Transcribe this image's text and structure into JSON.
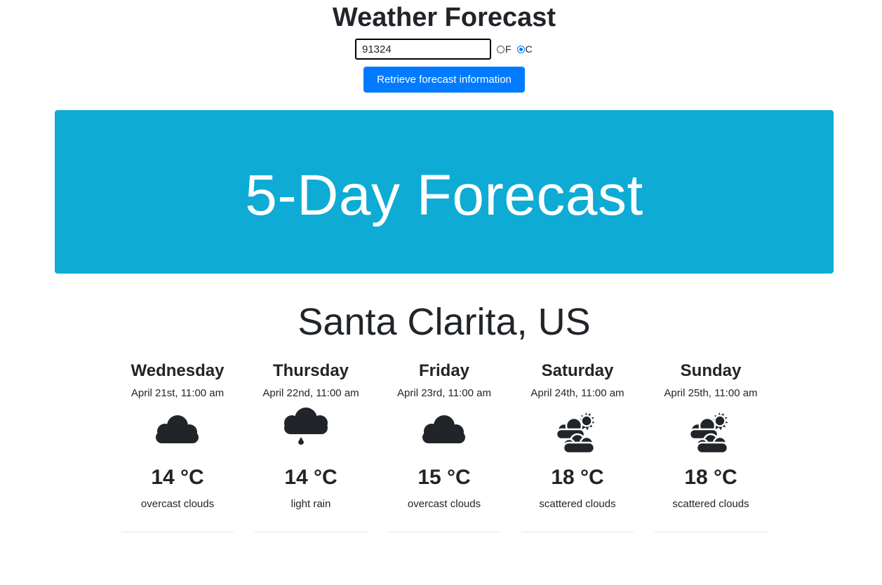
{
  "header": {
    "title": "Weather Forecast"
  },
  "form": {
    "zip_value": "91324",
    "unit_f_label": "F",
    "unit_c_label": "C",
    "selected_unit": "C",
    "submit_label": "Retrieve forecast information"
  },
  "jumbotron": {
    "title": "5-Day Forecast",
    "background_color": "#0eabd4"
  },
  "location": "Santa Clarita, US",
  "accent_color": "#007bff",
  "forecast": [
    {
      "day": "Wednesday",
      "date": "April 21st, 11:00 am",
      "icon": "cloudy-icon",
      "temp": "14 °C",
      "desc": "overcast clouds"
    },
    {
      "day": "Thursday",
      "date": "April 22nd, 11:00 am",
      "icon": "rain-icon",
      "temp": "14 °C",
      "desc": "light rain"
    },
    {
      "day": "Friday",
      "date": "April 23rd, 11:00 am",
      "icon": "cloudy-icon",
      "temp": "15 °C",
      "desc": "overcast clouds"
    },
    {
      "day": "Saturday",
      "date": "April 24th, 11:00 am",
      "icon": "partly-cloudy-icon",
      "temp": "18 °C",
      "desc": "scattered clouds"
    },
    {
      "day": "Sunday",
      "date": "April 25th, 11:00 am",
      "icon": "partly-cloudy-icon",
      "temp": "18 °C",
      "desc": "scattered clouds"
    }
  ]
}
